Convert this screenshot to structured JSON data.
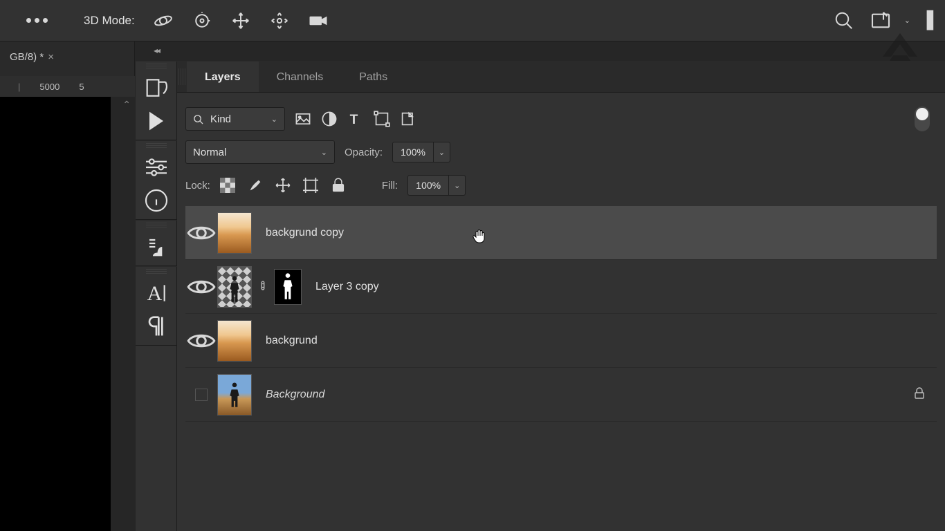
{
  "optionsBar": {
    "modeLabel": "3D Mode:"
  },
  "documentTab": {
    "title": "GB/8) *",
    "close": "×"
  },
  "ruler": {
    "mark1": "5000",
    "mark2": "5"
  },
  "panelTabs": {
    "layers": "Layers",
    "channels": "Channels",
    "paths": "Paths"
  },
  "layersPanel": {
    "filterKind": "Kind",
    "blendMode": "Normal",
    "opacityLabel": "Opacity:",
    "opacityValue": "100%",
    "lockLabel": "Lock:",
    "fillLabel": "Fill:",
    "fillValue": "100%"
  },
  "layers": [
    {
      "name": "backgrund copy",
      "visible": true,
      "selected": true,
      "masked": false,
      "thumb": "landscape",
      "locked": false,
      "italic": false
    },
    {
      "name": "Layer 3 copy",
      "visible": true,
      "selected": false,
      "masked": true,
      "thumb": "person-trans",
      "locked": false,
      "italic": false
    },
    {
      "name": "backgrund",
      "visible": true,
      "selected": false,
      "masked": false,
      "thumb": "landscape",
      "locked": false,
      "italic": false
    },
    {
      "name": "Background",
      "visible": false,
      "selected": false,
      "masked": false,
      "thumb": "person-sky",
      "locked": true,
      "italic": true
    }
  ]
}
